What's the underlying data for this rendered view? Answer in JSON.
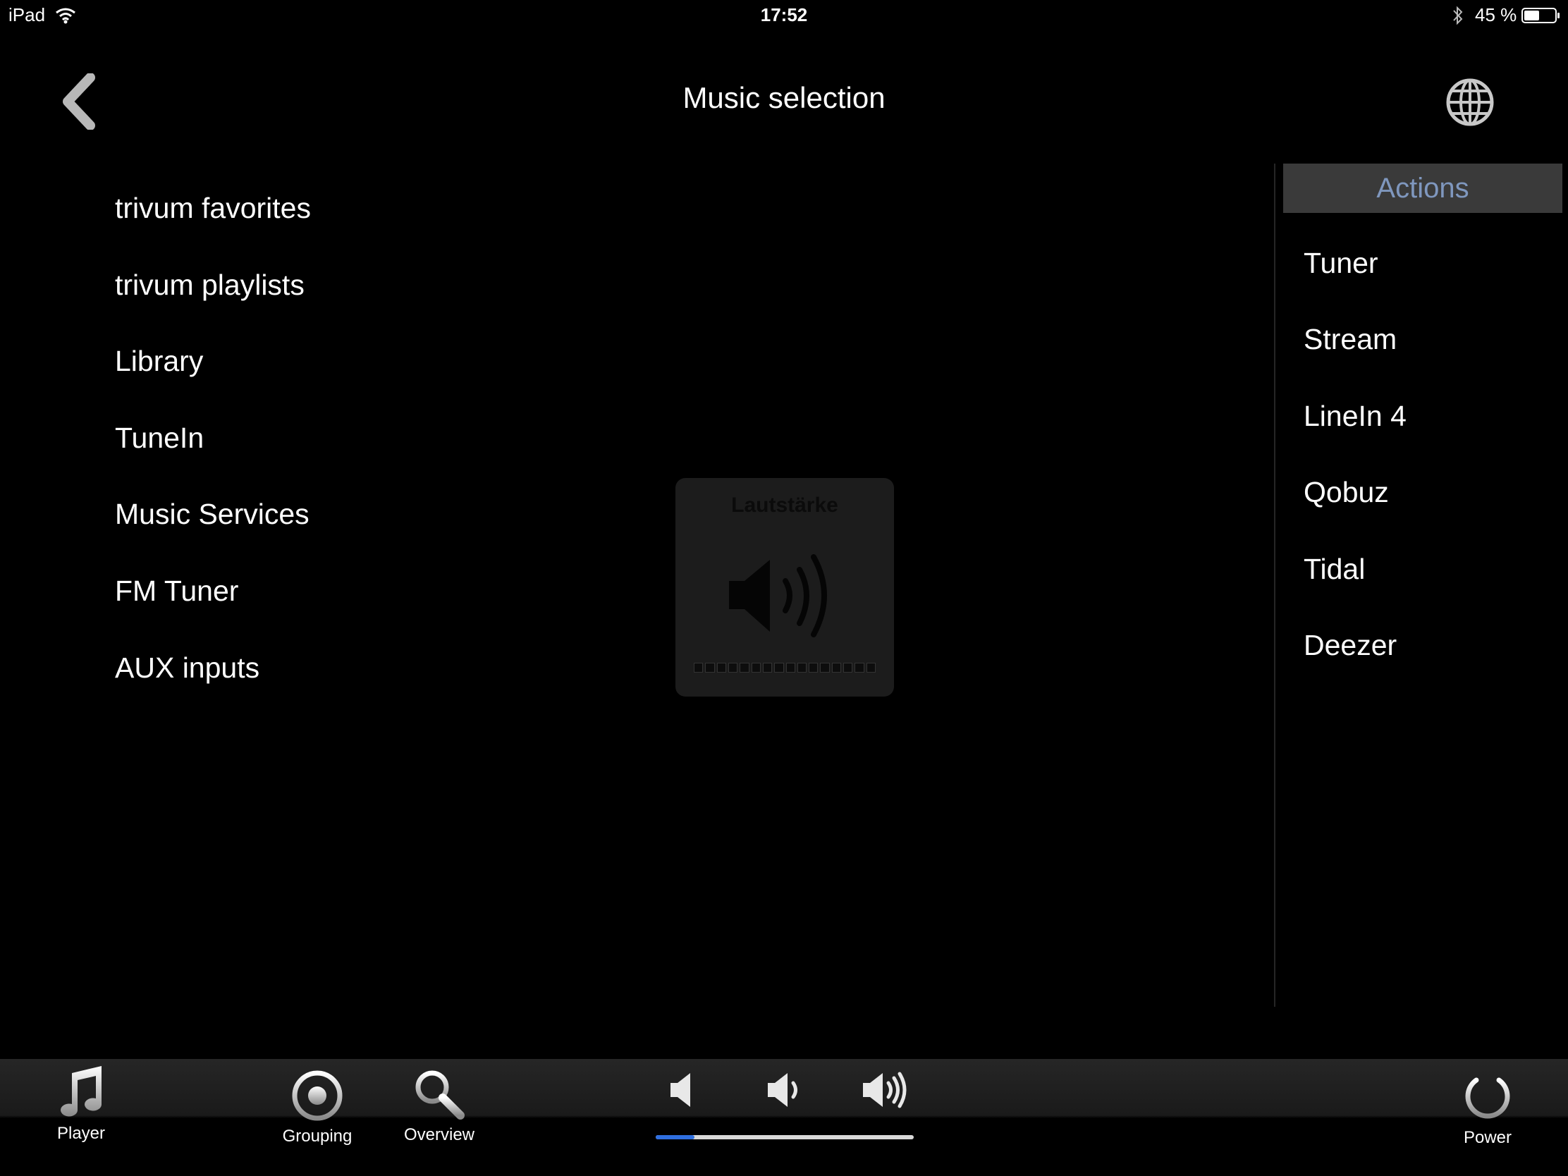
{
  "status_bar": {
    "device": "iPad",
    "time": "17:52",
    "battery": "45 %"
  },
  "header": {
    "title": "Music selection",
    "back_icon": "chevron-left-icon",
    "globe_icon": "globe-icon"
  },
  "left_menu": {
    "items": [
      "trivum favorites",
      "trivum playlists",
      "Library",
      "TuneIn",
      "Music Services",
      "FM Tuner",
      "AUX inputs"
    ]
  },
  "actions_panel": {
    "header": "Actions",
    "items": [
      "Tuner",
      "Stream",
      "LineIn 4",
      "Qobuz",
      "Tidal",
      "Deezer"
    ]
  },
  "volume_hud": {
    "title": "Lautstärke",
    "level_fraction": 0.0
  },
  "bottom_bar": {
    "tabs": {
      "player": "Player",
      "grouping": "Grouping",
      "overview": "Overview",
      "power": "Power"
    },
    "volume_fraction": 0.15
  },
  "colors": {
    "background": "#000000",
    "actions_header_bg": "#3a3a3a",
    "actions_header_text": "#7f97be",
    "slider_fill": "#2f6fe0"
  }
}
